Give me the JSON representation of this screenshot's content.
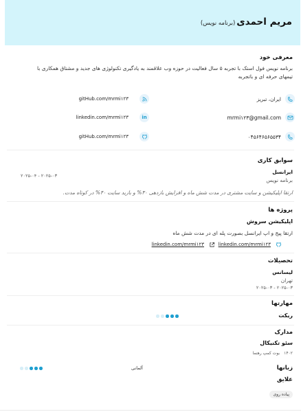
{
  "header": {
    "name": "مریم احمدی",
    "role": "(برنامه نویس)"
  },
  "about": {
    "title": "معرفی خود",
    "line1": "برنامه نویس فول استک با تجربه ۵ سال فعالیت در حوزه وب علاقمند به یادگیری تکنولوژی های جدید و مشتاق همکاری با",
    "line2": "تیمهای حرفه ای و باتجربه"
  },
  "contact": {
    "location": "ایران، تبریز",
    "email": "mrmi۱۲۳@gmail.com",
    "phone": "۰۴۵۶۴۶۵۶۵۵۳۴",
    "github1": "gitHub.com/mrmi۱۲۳",
    "linkedin": "linkedin.com/mrmi۱۲۳",
    "github2": "gitHub.com/mrmi۱۲۳"
  },
  "experience": {
    "title": "سوابق کاری",
    "company": "ایرانسل",
    "position": "برنامه نویس",
    "dates": "۲۰۲۵-۰۳ - ۲۰۲۵-۰۴",
    "desc": "ارتقا اپلیکیشن و سایت مشتری در مدت شش ماه و افزایش بازدهی ۳۰% و بازید سایت ۴۰% در کوتاه مدت."
  },
  "projects": {
    "title": "پروژه ها",
    "name": "اپلیکیشن سروش",
    "desc": "ارتقا پیج و اپ ایرانسل بصورت پله ای در مدت شش ماه",
    "link1": "linkedin.com/mrmi۱۲۳",
    "link2": "linkedin.com/mrmi۱۲۳"
  },
  "education": {
    "title": "تحصیلات",
    "degree": "لیسانس",
    "city": "تهران",
    "dates": "۲۰۲۵-۰۳ - ۲۰۲۵-۰۳"
  },
  "skills": {
    "title": "مهارتها",
    "name": "ریکت",
    "level": 3,
    "max": 5
  },
  "certificates": {
    "title": "مدارک",
    "name": "سئو تکنیکال",
    "issuer": "بوت کمپ رهنما",
    "year": "۱۴۰۲"
  },
  "languages": {
    "title": "زبانها",
    "name": "آلمانی",
    "level": 3,
    "max": 5
  },
  "interests": {
    "title": "علایق",
    "item": "پیاده روی"
  },
  "icon_color": "#1e9fd0"
}
